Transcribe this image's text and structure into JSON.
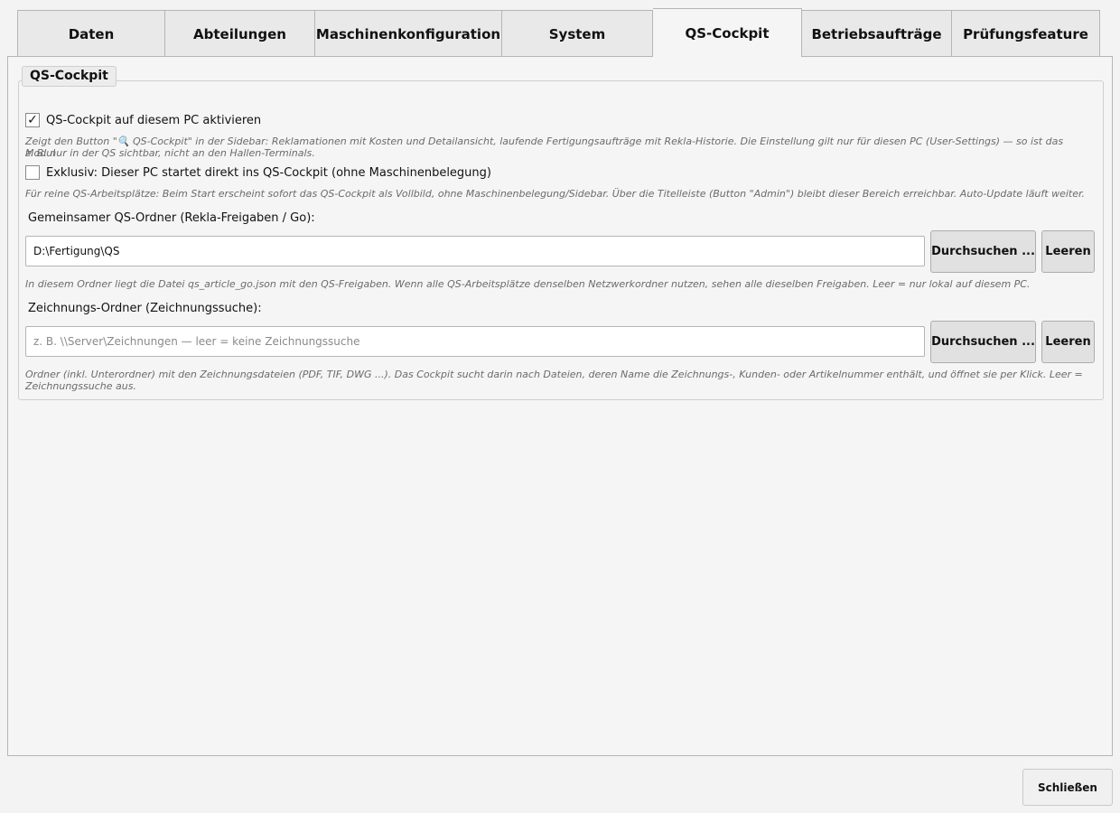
{
  "tabs": [
    {
      "label": "Daten"
    },
    {
      "label": "Abteilungen"
    },
    {
      "label": "Maschinenkonfiguration"
    },
    {
      "label": "System"
    },
    {
      "label": "QS-Cockpit"
    },
    {
      "label": "Betriebsaufträge"
    },
    {
      "label": "Prüfungsfeature"
    }
  ],
  "active_tab": "QS-Cockpit",
  "group": {
    "title": "QS-Cockpit",
    "activate": {
      "label": "QS-Cockpit auf diesem PC aktivieren",
      "checked": true,
      "hint_line1": "Zeigt den Button \"🔍 QS-Cockpit\" in der Sidebar: Reklamationen mit Kosten und Detailansicht, laufende Fertigungsaufträge mit Rekla-Historie. Die Einstellung gilt nur für diesen PC (User-Settings) — so ist das Modul",
      "hint_line2": "z. B. nur in der QS sichtbar, nicht an den Hallen-Terminals."
    },
    "exclusive": {
      "label": "Exklusiv: Dieser PC startet direkt ins QS-Cockpit (ohne Maschinenbelegung)",
      "checked": false,
      "hint": "Für reine QS-Arbeitsplätze: Beim Start erscheint sofort das QS-Cockpit als Vollbild, ohne Maschinenbelegung/Sidebar. Über die Titelleiste (Button \"Admin\") bleibt dieser Bereich erreichbar. Auto-Update läuft weiter."
    },
    "qs_folder": {
      "label": "Gemeinsamer QS-Ordner (Rekla-Freigaben / Go):",
      "value": "D:\\Fertigung\\QS",
      "browse_label": "Durchsuchen ...",
      "clear_label": "Leeren",
      "hint": "In diesem Ordner liegt die Datei qs_article_go.json mit den QS-Freigaben. Wenn alle QS-Arbeitsplätze denselben Netzwerkordner nutzen, sehen alle dieselben Freigaben. Leer = nur lokal auf diesem PC."
    },
    "drawing_folder": {
      "label": "Zeichnungs-Ordner (Zeichnungssuche):",
      "value": "",
      "placeholder": "z. B. \\\\Server\\Zeichnungen — leer = keine Zeichnungssuche",
      "browse_label": "Durchsuchen ...",
      "clear_label": "Leeren",
      "hint_line1": "Ordner (inkl. Unterordner) mit den Zeichnungsdateien (PDF, TIF, DWG ...). Das Cockpit sucht darin nach Dateien, deren Name die Zeichnungs-, Kunden- oder Artikelnummer enthält, und öffnet sie per Klick. Leer =",
      "hint_line2": "Zeichnungssuche aus."
    }
  },
  "footer": {
    "close_label": "Schließen"
  },
  "icons": {
    "checkmark": "check-icon"
  }
}
